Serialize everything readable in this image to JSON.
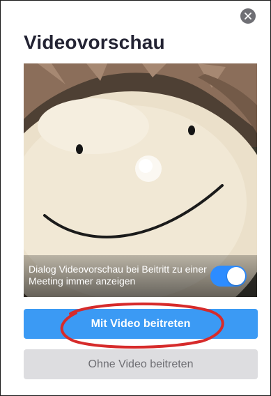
{
  "dialog": {
    "title": "Videovorschau",
    "close_icon": "close-icon"
  },
  "preview": {
    "option_text": "Dialog Videovorschau bei Beitritt zu einer Meeting immer anzeigen",
    "toggle_on": true,
    "toggle_color": "#2d8cff"
  },
  "buttons": {
    "join_with_video": "Mit Video beitreten",
    "join_without_video": "Ohne Video beitreten"
  },
  "colors": {
    "primary": "#3b9af4",
    "secondary": "#dddde0",
    "annotation": "#d62b2b"
  }
}
